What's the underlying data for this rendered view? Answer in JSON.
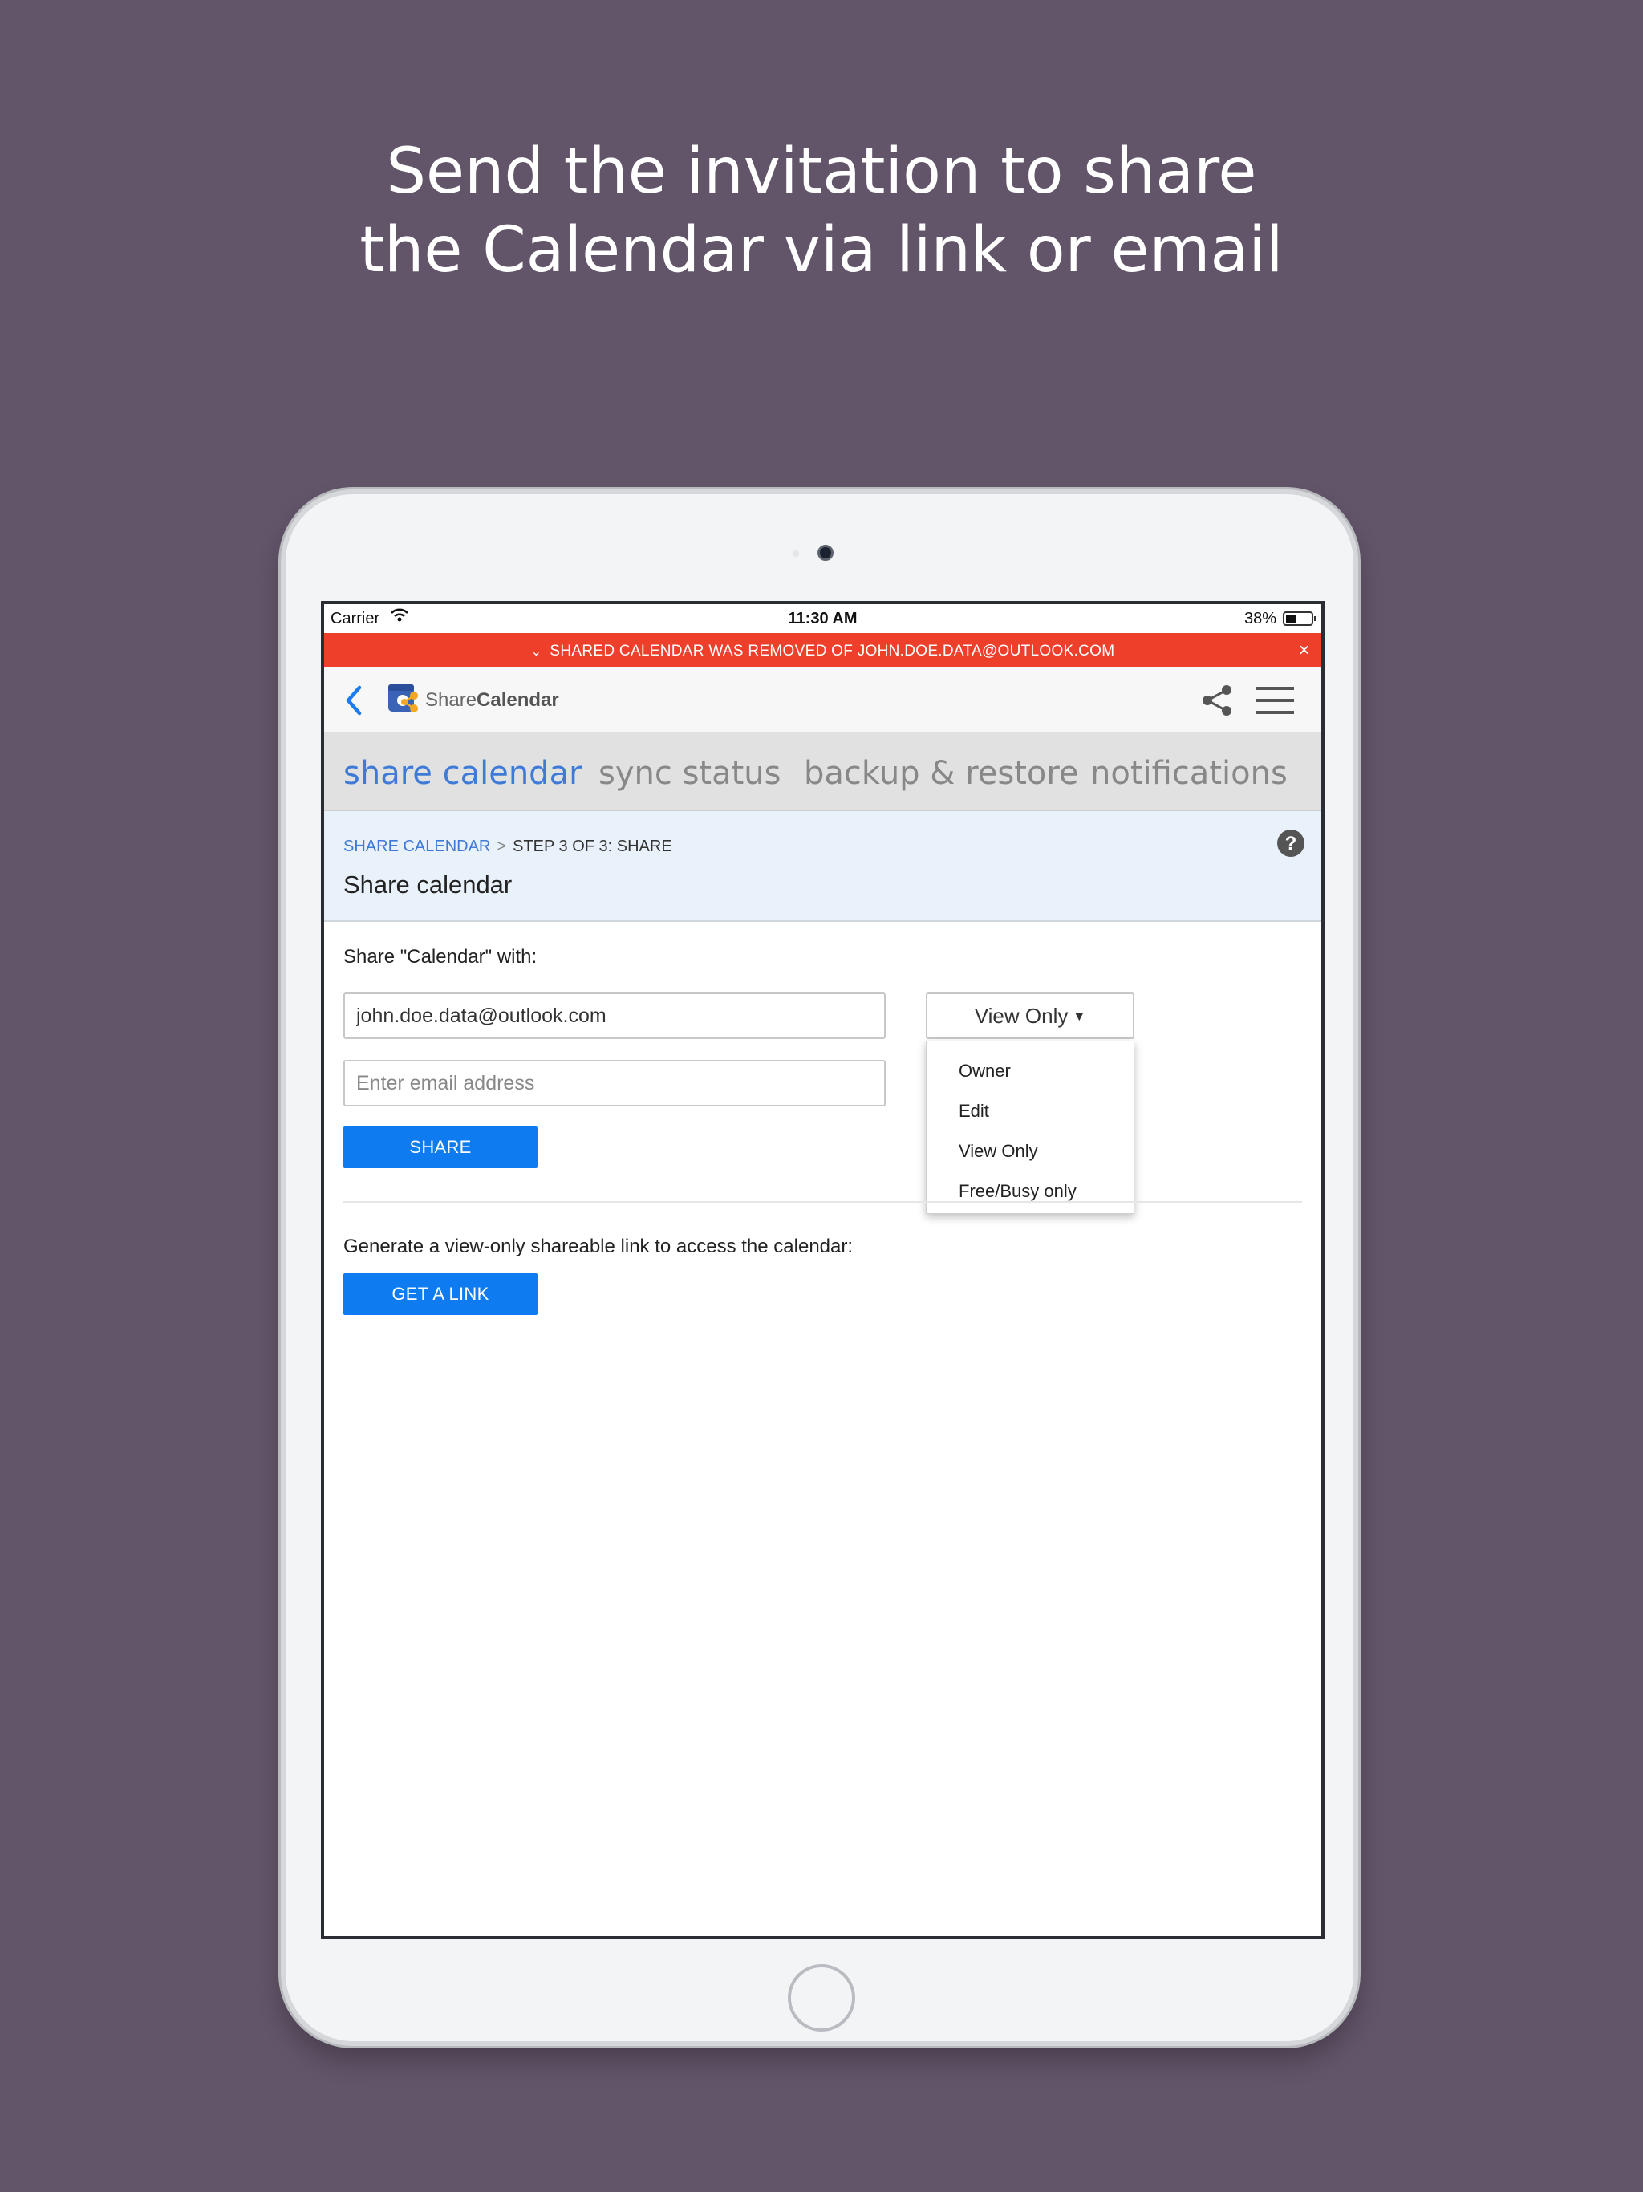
{
  "headline": {
    "line1": "Send the invitation to share",
    "line2": "the Calendar via link or email"
  },
  "statusbar": {
    "carrier": "Carrier",
    "time": "11:30 AM",
    "battery_pct": "38%"
  },
  "alert": {
    "text": "SHARED CALENDAR WAS REMOVED OF JOHN.DOE.DATA@OUTLOOK.COM",
    "color": "#ee3f2b"
  },
  "appbar": {
    "brand_share": "Share",
    "brand_calendar": "Calendar",
    "icons": [
      "back-icon",
      "logo",
      "share-icon",
      "menu-icon"
    ]
  },
  "tabs": [
    {
      "label": "share calendar",
      "active": true
    },
    {
      "label": "sync status",
      "active": false
    },
    {
      "label": "backup & restore",
      "active": false
    },
    {
      "label": "notifications",
      "active": false
    }
  ],
  "breadcrumb": {
    "root": "SHARE CALENDAR",
    "separator": ">",
    "current": "STEP 3 OF 3: SHARE"
  },
  "page_title": "Share calendar",
  "form": {
    "share_with_label": "Share \"Calendar\" with:",
    "email_value": "john.doe.data@outlook.com",
    "email_placeholder": "Enter email address",
    "role_selected": "View Only",
    "role_options": [
      "Owner",
      "Edit",
      "View Only",
      "Free/Busy only"
    ],
    "share_button": "SHARE"
  },
  "link_section": {
    "text": "Generate a view-only shareable link to access the calendar:",
    "button": "GET A LINK"
  },
  "colors": {
    "background": "#625469",
    "accent": "#3f7bd6",
    "button": "#0e7bf0"
  }
}
